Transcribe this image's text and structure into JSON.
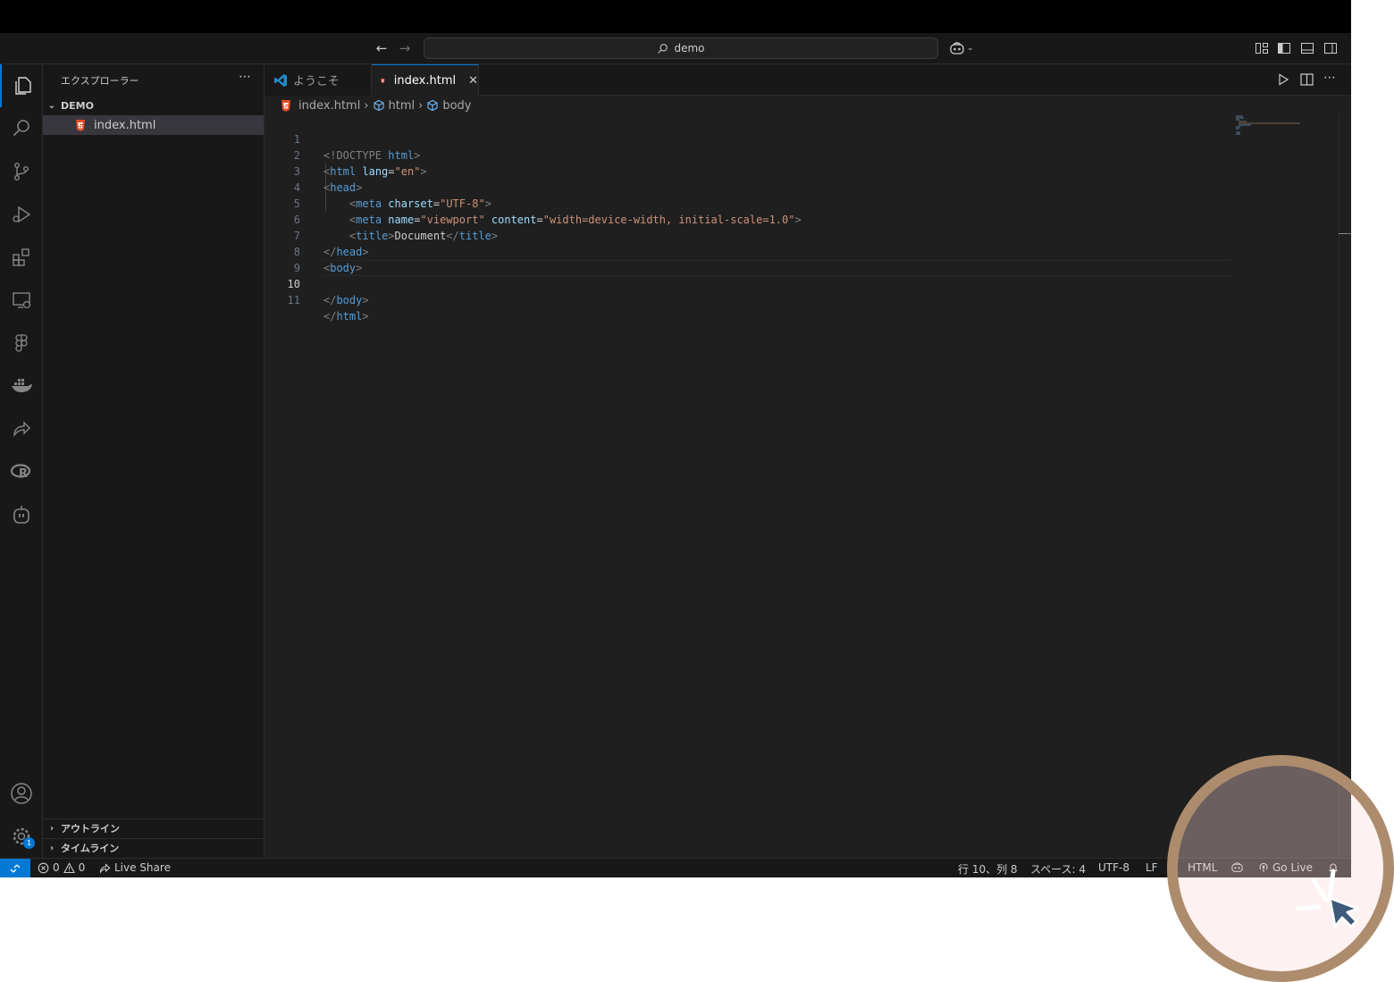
{
  "titlebar": {
    "search_text": "demo"
  },
  "sidebar": {
    "title": "エクスプローラー",
    "folder": "DEMO",
    "files": [
      {
        "name": "index.html"
      }
    ],
    "outline": "アウトライン",
    "timeline": "タイムライン"
  },
  "tabs": [
    {
      "label": "ようこそ",
      "active": false
    },
    {
      "label": "index.html",
      "active": true
    }
  ],
  "breadcrumb": {
    "file": "index.html",
    "node1": "html",
    "node2": "body"
  },
  "editor": {
    "current_line": 10,
    "line_numbers": [
      "1",
      "2",
      "3",
      "4",
      "5",
      "6",
      "7",
      "8",
      "9",
      "10",
      "11"
    ],
    "code": {
      "l1_doctype": "<!DOCTYPE",
      "l1_html": "html",
      "l1_close": ">",
      "l2_tag": "html",
      "l2_attr": "lang",
      "l2_val": "\"en\"",
      "l3_tag": "head",
      "l4_tag": "meta",
      "l4_attr": "charset",
      "l4_val": "\"UTF-8\"",
      "l5_tag": "meta",
      "l5_attr1": "name",
      "l5_val1": "\"viewport\"",
      "l5_attr2": "content",
      "l5_val2": "\"width=device-width, initial-scale=1.0\"",
      "l6_tag": "title",
      "l6_text": "Document",
      "l7_tag": "head",
      "l8_tag": "body",
      "l10_tag": "body",
      "l11_tag": "html"
    }
  },
  "activity_badge": "1",
  "status": {
    "errors": "0",
    "warnings": "0",
    "live_share": "Live Share",
    "position": "行 10、列 8",
    "spaces": "スペース: 4",
    "encoding": "UTF-8",
    "eol": "LF",
    "language": "HTML",
    "go_live": "Go Live"
  },
  "colors": {
    "accent": "#0078d4",
    "html_icon": "#e44d26",
    "overlay_ring": "#ad8c6e"
  }
}
